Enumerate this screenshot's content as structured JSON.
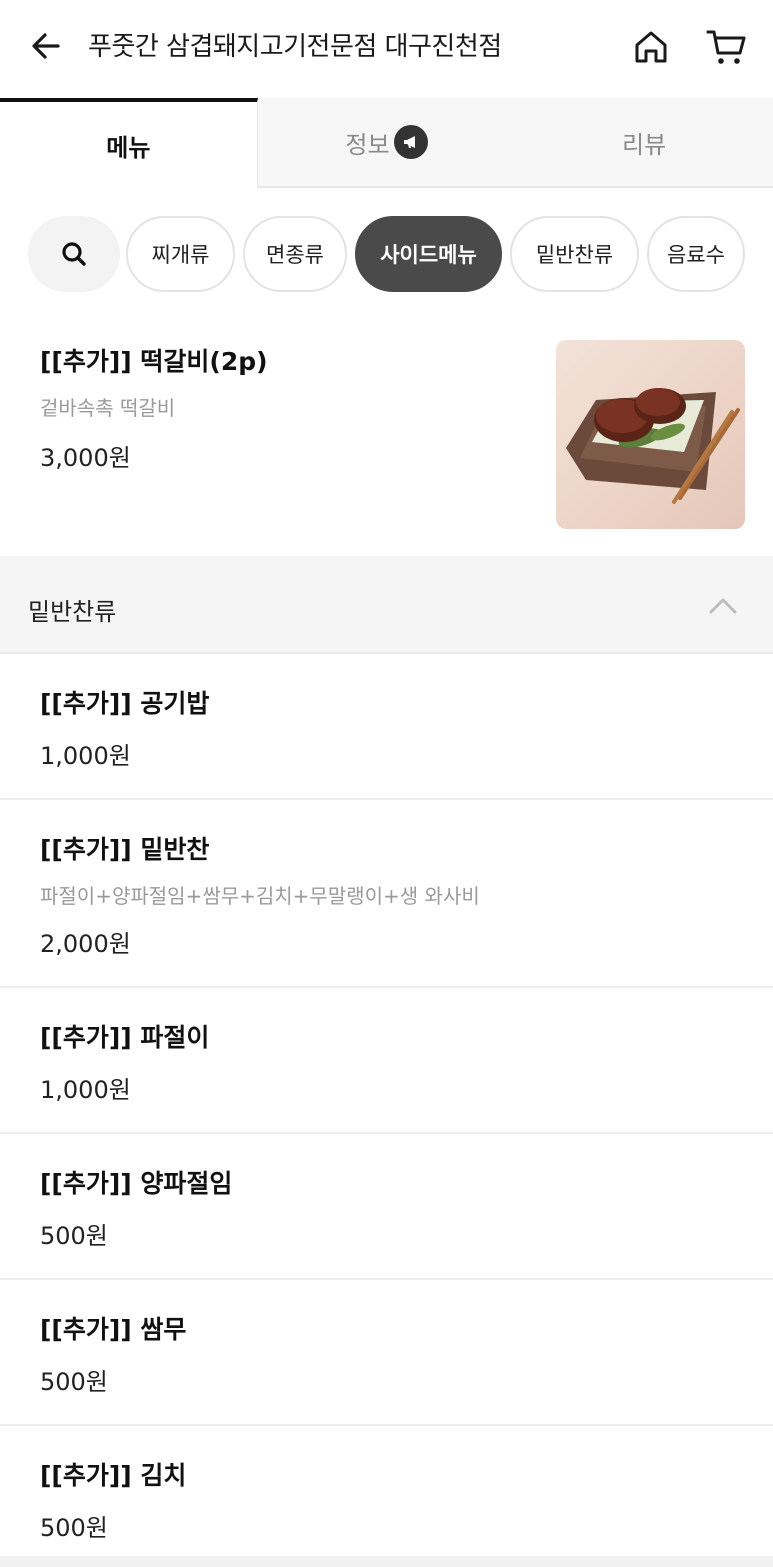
{
  "header": {
    "title": "푸줏간 삼겹돼지고기전문점 대구진천점",
    "back_icon": "arrow-left-icon",
    "home_icon": "home-icon",
    "cart_icon": "cart-icon"
  },
  "tabs": [
    {
      "label": "메뉴",
      "active": true
    },
    {
      "label": "정보",
      "icon": "megaphone-icon"
    },
    {
      "label": "리뷰"
    }
  ],
  "chips": [
    {
      "label": "찌개류"
    },
    {
      "label": "면종류"
    },
    {
      "label": "사이드메뉴",
      "active": true
    },
    {
      "label": "밑반찬류"
    },
    {
      "label": "음료수"
    }
  ],
  "featured": {
    "name": "[[추가]] 떡갈비(2p)",
    "desc": "겉바속촉 떡갈비",
    "price": "3,000원"
  },
  "section": {
    "title": "밑반찬류"
  },
  "items": [
    {
      "name": "[[추가]] 공기밥",
      "price": "1,000원"
    },
    {
      "name": "[[추가]] 밑반찬",
      "desc": "파절이+양파절임+쌈무+김치+무말랭이+생 와사비",
      "price": "2,000원"
    },
    {
      "name": "[[추가]] 파절이",
      "price": "1,000원"
    },
    {
      "name": "[[추가]] 양파절임",
      "price": "500원"
    },
    {
      "name": "[[추가]] 쌈무",
      "price": "500원"
    },
    {
      "name": "[[추가]] 김치",
      "price": "500원"
    }
  ],
  "colors": {
    "active_chip": "#4a4a4a",
    "muted_text": "#9a9a9a",
    "section_bg": "#f5f5f5"
  }
}
